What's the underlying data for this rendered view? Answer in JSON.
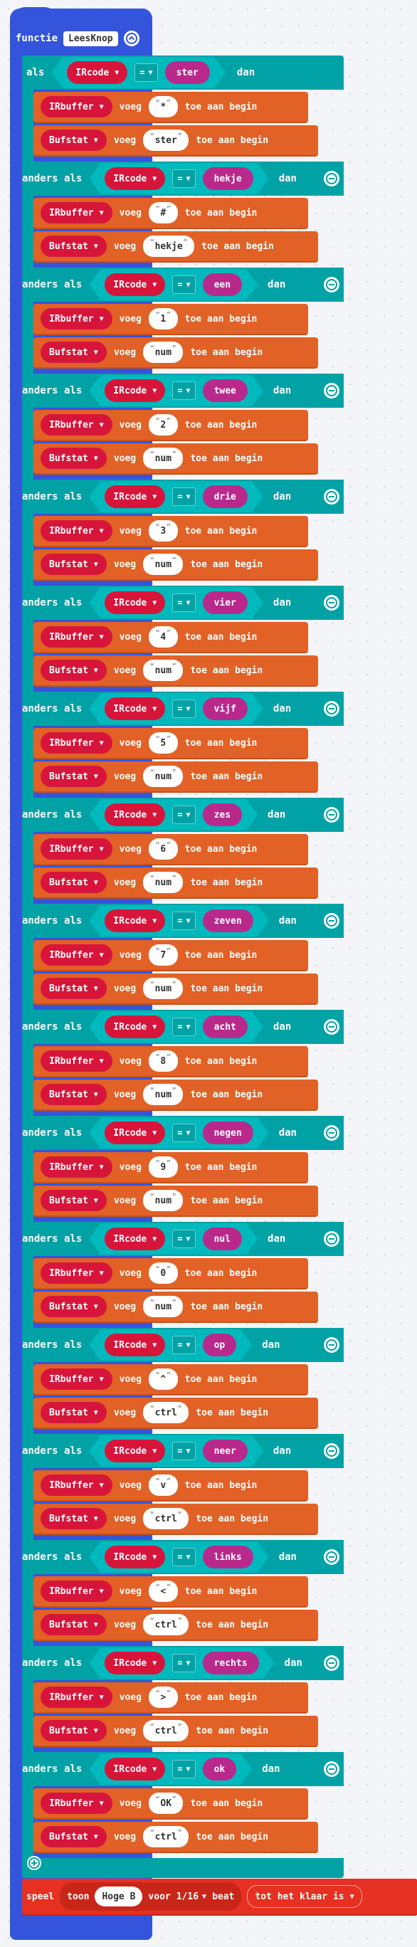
{
  "function": {
    "keyword": "functie",
    "name": "LeesKnop"
  },
  "labels": {
    "if": "als",
    "else_if": "anders als",
    "then": "dan",
    "prepend": "voeg",
    "to_begin": "toe aan begin"
  },
  "compare": {
    "variable": "IRcode",
    "operator": "="
  },
  "branches": [
    {
      "code": "ster",
      "ir": "*",
      "stat": "ster"
    },
    {
      "code": "hekje",
      "ir": "#",
      "stat": "hekje"
    },
    {
      "code": "een",
      "ir": "1",
      "stat": "num"
    },
    {
      "code": "twee",
      "ir": "2",
      "stat": "num"
    },
    {
      "code": "drie",
      "ir": "3",
      "stat": "num"
    },
    {
      "code": "vier",
      "ir": "4",
      "stat": "num"
    },
    {
      "code": "vijf",
      "ir": "5",
      "stat": "num"
    },
    {
      "code": "zes",
      "ir": "6",
      "stat": "num"
    },
    {
      "code": "zeven",
      "ir": "7",
      "stat": "num"
    },
    {
      "code": "acht",
      "ir": "8",
      "stat": "num"
    },
    {
      "code": "negen",
      "ir": "9",
      "stat": "num"
    },
    {
      "code": "nul",
      "ir": "0",
      "stat": "num"
    },
    {
      "code": "op",
      "ir": "^",
      "stat": "ctrl"
    },
    {
      "code": "neer",
      "ir": "v",
      "stat": "ctrl"
    },
    {
      "code": "links",
      "ir": "<",
      "stat": "ctrl"
    },
    {
      "code": "rechts",
      "ir": ">",
      "stat": "ctrl"
    },
    {
      "code": "ok",
      "ir": "OK",
      "stat": "ctrl"
    }
  ],
  "arrays": {
    "first": "IRbuffer",
    "second": "Bufstat"
  },
  "music": {
    "play": "speel",
    "tone": "toon",
    "note": "Hoge B",
    "for": "voor",
    "beat": "1/16",
    "beat_unit": "beat",
    "mode": "tot het klaar is"
  },
  "colors": {
    "function": "#3455db",
    "logic": "#00a2a6",
    "variable": "#d7153b",
    "array": "#e26126",
    "string": "#b9298c",
    "music": "#e63022"
  },
  "icons": {
    "collapse": "collapse-up-icon",
    "remove_branch": "minus-circle-icon",
    "add_branch": "plus-circle-icon",
    "dropdown": "caret-down-icon"
  }
}
